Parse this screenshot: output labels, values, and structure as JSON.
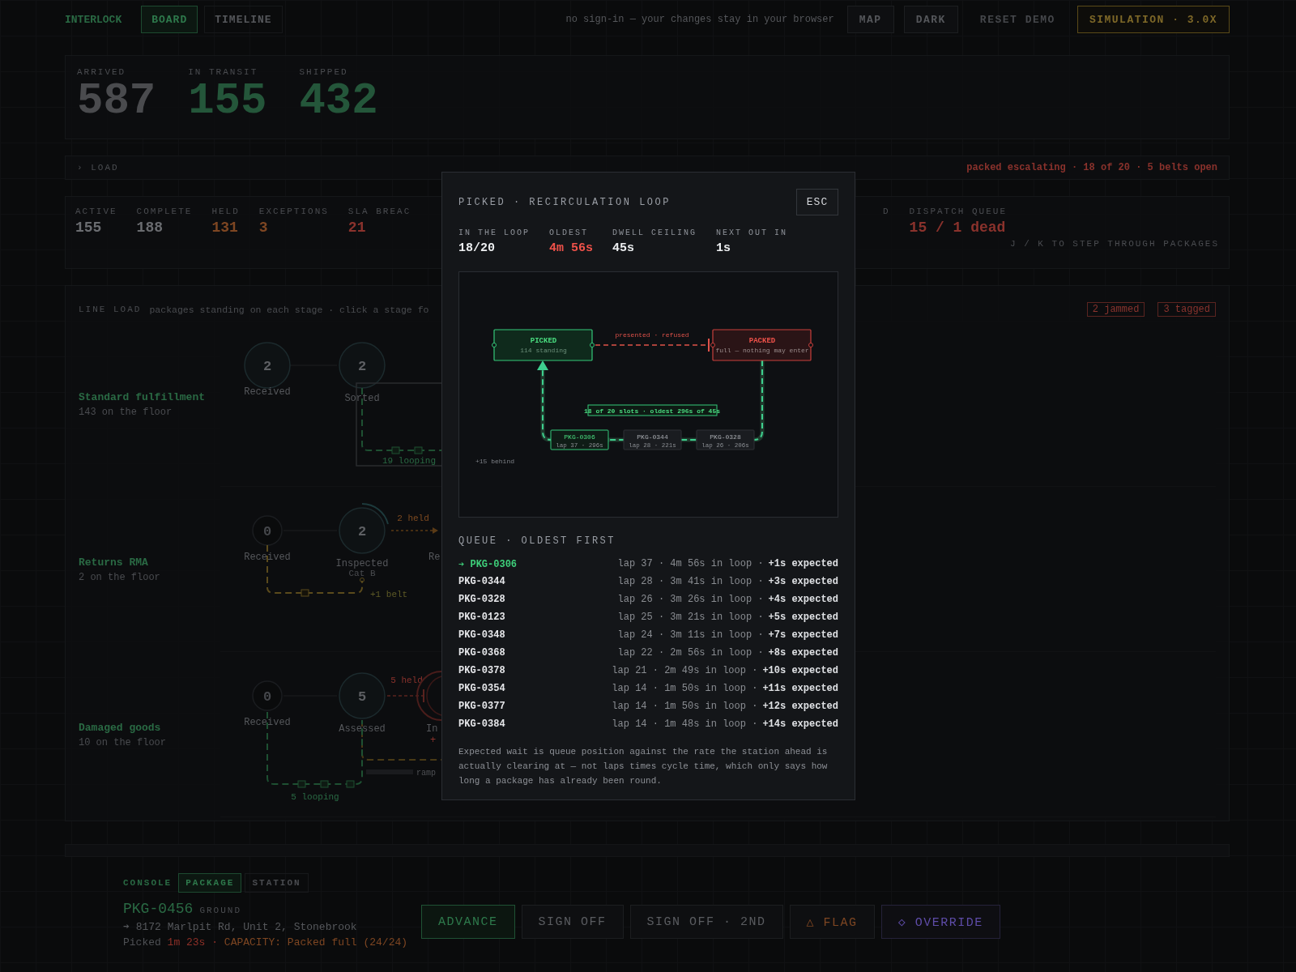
{
  "topbar": {
    "brand": "INTERLOCK",
    "tabs": [
      {
        "label": "BOARD",
        "selected": true
      },
      {
        "label": "TIMELINE",
        "selected": false
      }
    ],
    "notice": "no sign-in — your changes stay in your browser",
    "actions": [
      {
        "label": "MAP",
        "kind": "plain"
      },
      {
        "label": "DARK",
        "kind": "plain"
      },
      {
        "label": "RESET DEMO",
        "kind": "ghost"
      },
      {
        "label": "SIMULATION · 3.0X",
        "kind": "speed"
      }
    ]
  },
  "counters": [
    {
      "label": "ARRIVED",
      "value": "587",
      "color": "#4a4b4e"
    },
    {
      "label": "IN TRANSIT",
      "value": "155",
      "color": "#24563a"
    },
    {
      "label": "SHIPPED",
      "value": "432",
      "color": "#24563a"
    }
  ],
  "load_bar": {
    "label": "› LOAD",
    "alert": "packed escalating · 18 of 20 · 5 belts open"
  },
  "stats": {
    "items": [
      {
        "label": "ACTIVE",
        "value": "155",
        "color": "#6a6c70"
      },
      {
        "label": "COMPLETE",
        "value": "188",
        "color": "#6a6c70"
      },
      {
        "label": "HELD",
        "value": "131",
        "color": "#7e4622"
      },
      {
        "label": "EXCEPTIONS",
        "value": "3",
        "color": "#7e4622"
      },
      {
        "label": "SLA BREAC",
        "value": "21",
        "color": "#8a322c"
      }
    ],
    "items_right": [
      {
        "label": "D"
      },
      {
        "label": "DISPATCH QUEUE",
        "value": "15 / 1 dead",
        "color": "#8a322c"
      }
    ],
    "hint": "J / K TO STEP THROUGH PACKAGES"
  },
  "line_load": {
    "title": "LINE LOAD",
    "subtitle": "packages standing on each stage · click a stage fo",
    "tags": [
      "2 jammed",
      "3 tagged"
    ],
    "lanes": [
      {
        "kind": "loop",
        "name": "Standard fulfillment",
        "count": "143 on the floor",
        "nodes": [
          {
            "value": "2",
            "label": "Received",
            "idle": false
          },
          {
            "value": "2",
            "label": "Sorted",
            "idle": false
          }
        ],
        "loop": "19 looping"
      },
      {
        "kind": "held",
        "name": "Returns RMA",
        "count": "2 on the floor",
        "nodes": [
          {
            "value": "0",
            "label": "Received",
            "idle": true
          },
          {
            "value": "2",
            "label": "Inspected",
            "sub": "Cat B",
            "idle": false
          }
        ],
        "held": "2 held",
        "next": "Re",
        "belt": "+1 belt"
      },
      {
        "kind": "blocked",
        "name": "Damaged goods",
        "count": "10 on the floor",
        "nodes": [
          {
            "value": "0",
            "label": "Received",
            "idle": true
          },
          {
            "value": "5",
            "label": "Assessed",
            "idle": false
          }
        ],
        "held": "5 held",
        "next": "In",
        "next_sub": "+",
        "ramp": "ramp",
        "loop": "5 looping"
      }
    ]
  },
  "console": {
    "title": "CONSOLE",
    "tabs": [
      {
        "label": "PACKAGE",
        "selected": true
      },
      {
        "label": "STATION",
        "selected": false
      }
    ],
    "package": "PKG-0456",
    "status": "GROUND",
    "address": "➔ 8172 Marlpit Rd, Unit 2, Stonebrook",
    "timing": [
      {
        "text": "Picked",
        "color": "#4e5054"
      },
      {
        "text": "1m 23s ·",
        "color": "#8e3028"
      },
      {
        "text": "CAPACITY: Packed full (24/24)",
        "color": "#7e4622"
      }
    ],
    "actions": [
      {
        "label": "ADVANCE",
        "kind": "primary"
      },
      {
        "label": "SIGN OFF",
        "kind": "plain"
      },
      {
        "label": "SIGN OFF · 2ND",
        "kind": "plain"
      },
      {
        "icon": "△",
        "label": "FLAG",
        "kind": "warn"
      },
      {
        "icon": "◇",
        "label": "OVERRIDE",
        "kind": "special"
      }
    ]
  },
  "dialog": {
    "title": "PICKED · RECIRCULATION LOOP",
    "close": "ESC",
    "stats": [
      {
        "label": "IN THE LOOP",
        "value": "18/20",
        "alert": false
      },
      {
        "label": "OLDEST",
        "value": "4m 56s",
        "alert": true
      },
      {
        "label": "DWELL CEILING",
        "value": "45s",
        "alert": false
      },
      {
        "label": "NEXT OUT IN",
        "value": "1s",
        "alert": false
      }
    ],
    "diagram": {
      "source": {
        "name": "PICKED",
        "detail": "114 standing"
      },
      "target": {
        "name": "PACKED",
        "detail": "full — nothing may enter"
      },
      "edge": "presented · refused",
      "loop_label": "18 of 20 slots · oldest 296s of 45s",
      "slots": [
        {
          "id": "PKG-0306",
          "detail": "lap 37 · 296s",
          "selected": true
        },
        {
          "id": "PKG-0344",
          "detail": "lap 28 · 221s",
          "selected": false
        },
        {
          "id": "PKG-0328",
          "detail": "lap 26 · 206s",
          "selected": false
        }
      ],
      "overflow": "+15 behind"
    },
    "queue_title": "QUEUE · OLDEST FIRST",
    "queue": [
      {
        "marker": "➔",
        "id": "PKG-0306",
        "detail": "lap 37 · 4m 56s in loop ·",
        "expected": "+1s expected",
        "selected": true
      },
      {
        "id": "PKG-0344",
        "detail": "lap 28 · 3m 41s in loop ·",
        "expected": "+3s expected",
        "selected": false
      },
      {
        "id": "PKG-0328",
        "detail": "lap 26 · 3m 26s in loop ·",
        "expected": "+4s expected",
        "selected": false
      },
      {
        "id": "PKG-0123",
        "detail": "lap 25 · 3m 21s in loop ·",
        "expected": "+5s expected",
        "selected": false
      },
      {
        "id": "PKG-0348",
        "detail": "lap 24 · 3m 11s in loop ·",
        "expected": "+7s expected",
        "selected": false
      },
      {
        "id": "PKG-0368",
        "detail": "lap 22 · 2m 56s in loop ·",
        "expected": "+8s expected",
        "selected": false
      },
      {
        "id": "PKG-0378",
        "detail": "lap 21 · 2m 49s in loop ·",
        "expected": "+10s expected",
        "selected": false
      },
      {
        "id": "PKG-0354",
        "detail": "lap 14 · 1m 50s in loop ·",
        "expected": "+11s expected",
        "selected": false
      },
      {
        "id": "PKG-0377",
        "detail": "lap 14 · 1m 50s in loop ·",
        "expected": "+12s expected",
        "selected": false
      },
      {
        "id": "PKG-0384",
        "detail": "lap 14 · 1m 48s in loop ·",
        "expected": "+14s expected",
        "selected": false
      }
    ],
    "note": "Expected wait is queue position against the rate the station ahead is actually clearing at — not laps times cycle time, which only says how long a package has already been round."
  }
}
